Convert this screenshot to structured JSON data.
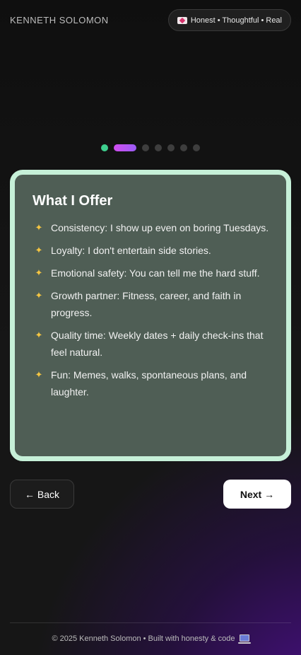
{
  "header": {
    "brand": "KENNETH SOLOMON",
    "tagline": "Honest • Thoughtful • Real",
    "tagline_icon": "heart-letter-icon"
  },
  "progress": {
    "total_steps": 7,
    "current_step": 2
  },
  "card": {
    "title": "What I Offer",
    "bullet_icon": "sparkles-icon",
    "items": [
      {
        "label": "Consistency: I show up even on boring Tuesdays."
      },
      {
        "label": "Loyalty: I don't entertain side stories."
      },
      {
        "label": "Emotional safety: You can tell me the hard stuff."
      },
      {
        "label": "Growth partner: Fitness, career, and faith in progress."
      },
      {
        "label": "Quality time: Weekly dates + daily check-ins that feel natural."
      },
      {
        "label": "Fun: Memes, walks, spontaneous plans, and laughter."
      }
    ]
  },
  "nav": {
    "back_label": "← Back",
    "next_label": "Next →"
  },
  "footer": {
    "text": "© 2025 Kenneth Solomon • Built with honesty & code",
    "icon": "laptop-icon"
  },
  "colors": {
    "card_border": "#c6f0d8",
    "card_bg": "#4f5e55",
    "dot_done": "#3ecf8e",
    "dot_active_start": "#d14ef0",
    "dot_active_end": "#9a5cf5",
    "background_glow": "#4c108c"
  }
}
